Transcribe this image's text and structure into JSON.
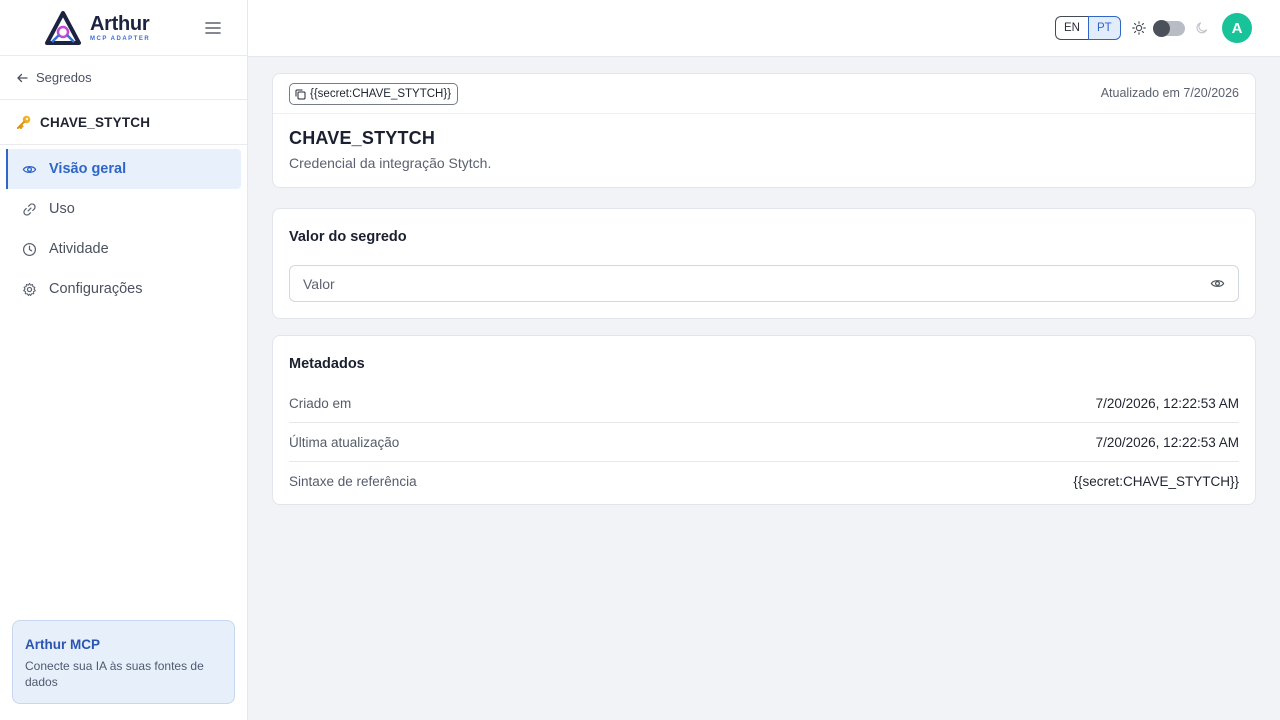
{
  "brand": {
    "name": "Arthur",
    "subtitle": "MCP ADAPTER"
  },
  "sidebar": {
    "back_label": "Segredos",
    "secret_name": "CHAVE_STYTCH",
    "nav": [
      {
        "label": "Visão geral",
        "icon": "eye-icon",
        "active": true
      },
      {
        "label": "Uso",
        "icon": "link-icon",
        "active": false
      },
      {
        "label": "Atividade",
        "icon": "clock-icon",
        "active": false
      },
      {
        "label": "Configurações",
        "icon": "gear-icon",
        "active": false
      }
    ],
    "promo": {
      "title": "Arthur MCP",
      "description": "Conecte sua IA às suas fontes de dados"
    }
  },
  "topbar": {
    "languages": [
      "EN",
      "PT"
    ],
    "selected_language": "PT",
    "theme_dark": false,
    "avatar_initial": "A"
  },
  "header_card": {
    "reference_chip": "{{secret:CHAVE_STYTCH}}",
    "updated": "Atualizado em 7/20/2026",
    "title": "CHAVE_STYTCH",
    "description": "Credencial da integração Stytch."
  },
  "value_card": {
    "title": "Valor do segredo",
    "placeholder": "Valor",
    "value": ""
  },
  "metadata_card": {
    "title": "Metadados",
    "rows": [
      {
        "key": "Criado em",
        "value": "7/20/2026, 12:22:53 AM"
      },
      {
        "key": "Última atualização",
        "value": "7/20/2026, 12:22:53 AM"
      },
      {
        "key": "Sintaxe de referência",
        "value": "{{secret:CHAVE_STYTCH}}"
      }
    ]
  },
  "colors": {
    "accent": "#2f66c7",
    "avatar": "#19c39a",
    "active_bg": "#e8f0fb"
  }
}
